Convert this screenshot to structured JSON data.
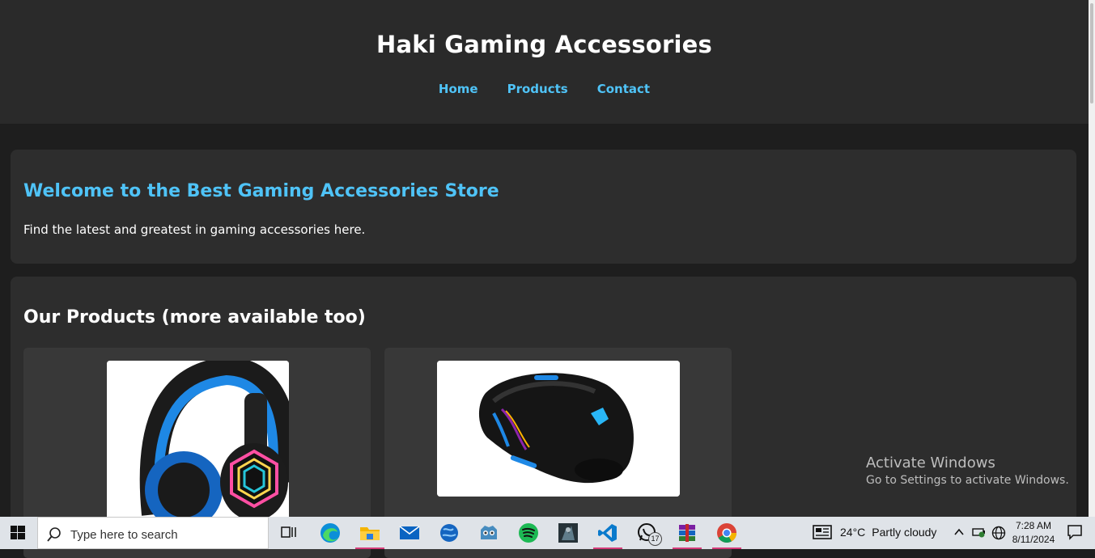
{
  "header": {
    "title": "Haki Gaming Accessories",
    "nav": [
      "Home",
      "Products",
      "Contact"
    ]
  },
  "welcome": {
    "heading": "Welcome to the Best Gaming Accessories Store",
    "text": "Find the latest and greatest in gaming accessories here."
  },
  "products": {
    "heading": "Our Products (more available too)",
    "items": [
      {
        "image": "gaming-headset"
      },
      {
        "image": "gaming-mouse"
      }
    ]
  },
  "watermark": {
    "line1": "Activate Windows",
    "line2": "Go to Settings to activate Windows."
  },
  "taskbar": {
    "search_placeholder": "Type here to search",
    "apps": [
      "task-view",
      "edge",
      "file-explorer",
      "mail",
      "browser-globe",
      "godot",
      "spotify",
      "game",
      "vscode",
      "whatsapp",
      "winrar",
      "chrome"
    ],
    "whatsapp_badge": "17",
    "weather_temp": "24°C",
    "weather_desc": "Partly cloudy",
    "time": "7:28 AM",
    "date": "8/11/2024"
  },
  "colors": {
    "accent": "#4fc3f7",
    "header_bg": "#2a2a2a",
    "panel_bg": "#2d2d2d",
    "page_bg": "#1e1e1e"
  }
}
